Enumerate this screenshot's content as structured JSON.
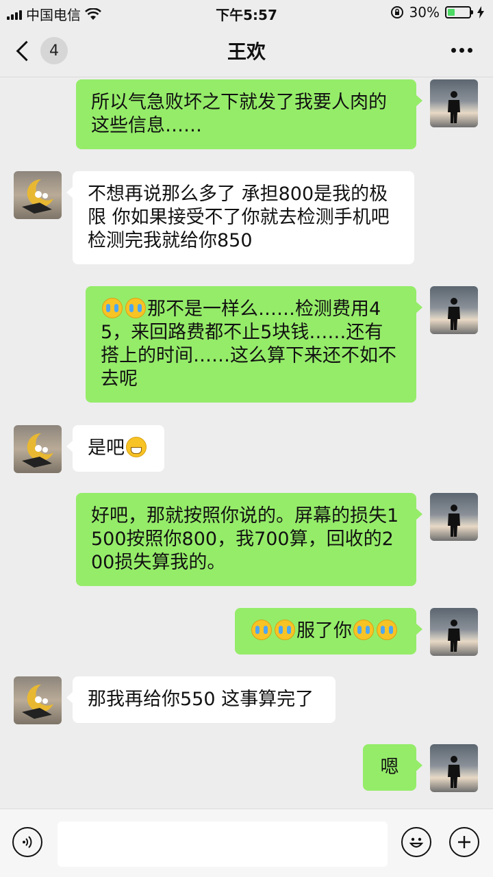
{
  "status_bar": {
    "carrier": "中国电信",
    "time": "下午5:57",
    "battery_percent": "30%",
    "battery_level": 0.3,
    "icons": [
      "signal-icon",
      "wifi-icon",
      "rotation-lock-icon",
      "battery-icon",
      "charging-icon"
    ]
  },
  "header": {
    "back_unread_count": "4",
    "title": "王欢",
    "more_icon": "more-dots-icon"
  },
  "messages": [
    {
      "sender": "me",
      "text": "所以气急败坏之下就发了我要人肉的这些信息……"
    },
    {
      "sender": "them",
      "text": "不想再说那么多了 承担800是我的极限 你如果接受不了你就去检测手机吧 检测完我就给你850"
    },
    {
      "sender": "me",
      "emoji_before": [
        "cry-emoji",
        "cry-emoji"
      ],
      "text": "那不是一样么……检测费用45，来回路费都不止5块钱……还有搭上的时间……这么算下来还不如不去呢"
    },
    {
      "sender": "them",
      "text": "是吧",
      "emoji_after": [
        "grin-emoji"
      ]
    },
    {
      "sender": "me",
      "text": "好吧，那就按照你说的。屏幕的损失1500按照你800，我700算，回收的200损失算我的。"
    },
    {
      "sender": "me",
      "emoji_before": [
        "cry-emoji",
        "cry-emoji"
      ],
      "text": "服了你",
      "emoji_after": [
        "cry-emoji",
        "cry-emoji"
      ]
    },
    {
      "sender": "them",
      "text": "那我再给你550 这事算完了"
    },
    {
      "sender": "me",
      "text": "嗯"
    }
  ],
  "input_bar": {
    "voice_icon": "voice-icon",
    "placeholder": "",
    "emoji_icon": "emoji-icon",
    "add_icon": "plus-icon"
  },
  "colors": {
    "background": "#ededed",
    "my_bubble": "#95ec69",
    "their_bubble": "#ffffff",
    "battery_fill": "#4cd964"
  }
}
